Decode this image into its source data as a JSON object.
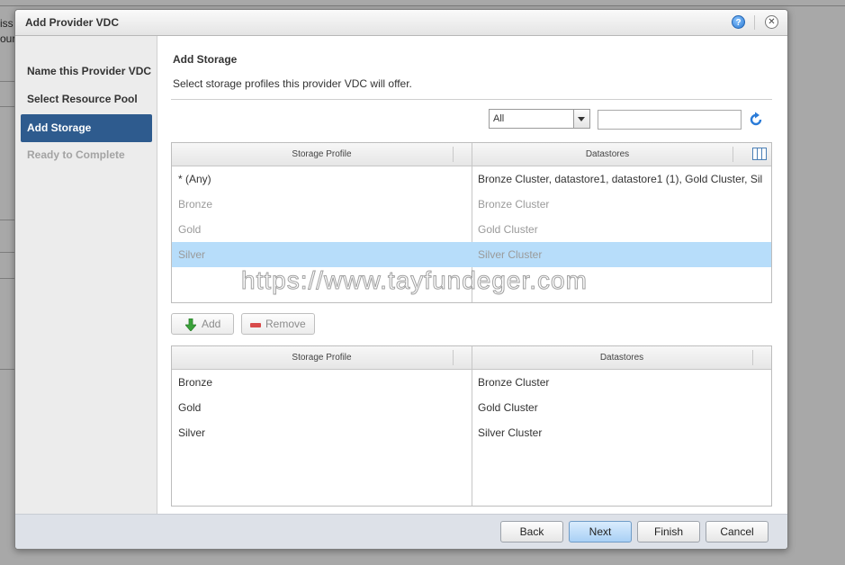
{
  "background": {
    "fragments": [
      "iss",
      "our"
    ]
  },
  "dialog": {
    "title": "Add Provider VDC",
    "help_glyph": "?",
    "close_glyph": "✕"
  },
  "nav": {
    "items": [
      {
        "label": "Name this Provider VDC",
        "state": "done"
      },
      {
        "label": "Select Resource Pool",
        "state": "done"
      },
      {
        "label": "Add Storage",
        "state": "active"
      },
      {
        "label": "Ready to Complete",
        "state": "disabled"
      }
    ]
  },
  "page": {
    "heading": "Add Storage",
    "description": "Select storage profiles this provider VDC will offer."
  },
  "filter": {
    "select_value": "All",
    "search_value": "",
    "search_placeholder": ""
  },
  "available_table": {
    "columns": [
      "Storage Profile",
      "Datastores"
    ],
    "rows": [
      {
        "profile": "* (Any)",
        "datastores": "Bronze Cluster, datastore1, datastore1 (1), Gold Cluster, Sil",
        "dim": false,
        "selected": false
      },
      {
        "profile": "Bronze",
        "datastores": "Bronze Cluster",
        "dim": true,
        "selected": false
      },
      {
        "profile": "Gold",
        "datastores": "Gold Cluster",
        "dim": true,
        "selected": false
      },
      {
        "profile": "Silver",
        "datastores": "Silver Cluster",
        "dim": true,
        "selected": true
      }
    ]
  },
  "actions": {
    "add_label": "Add",
    "remove_label": "Remove"
  },
  "selected_table": {
    "columns": [
      "Storage Profile",
      "Datastores"
    ],
    "rows": [
      {
        "profile": "Bronze",
        "datastores": "Bronze Cluster"
      },
      {
        "profile": "Gold",
        "datastores": "Gold Cluster"
      },
      {
        "profile": "Silver",
        "datastores": "Silver Cluster"
      }
    ]
  },
  "watermark": "https://www.tayfundeger.com",
  "footer": {
    "back": "Back",
    "next": "Next",
    "finish": "Finish",
    "cancel": "Cancel"
  },
  "colors": {
    "active_nav": "#2e5b8e",
    "selected_row": "#b7ddfa",
    "primary_button": "#a9d0f5"
  }
}
